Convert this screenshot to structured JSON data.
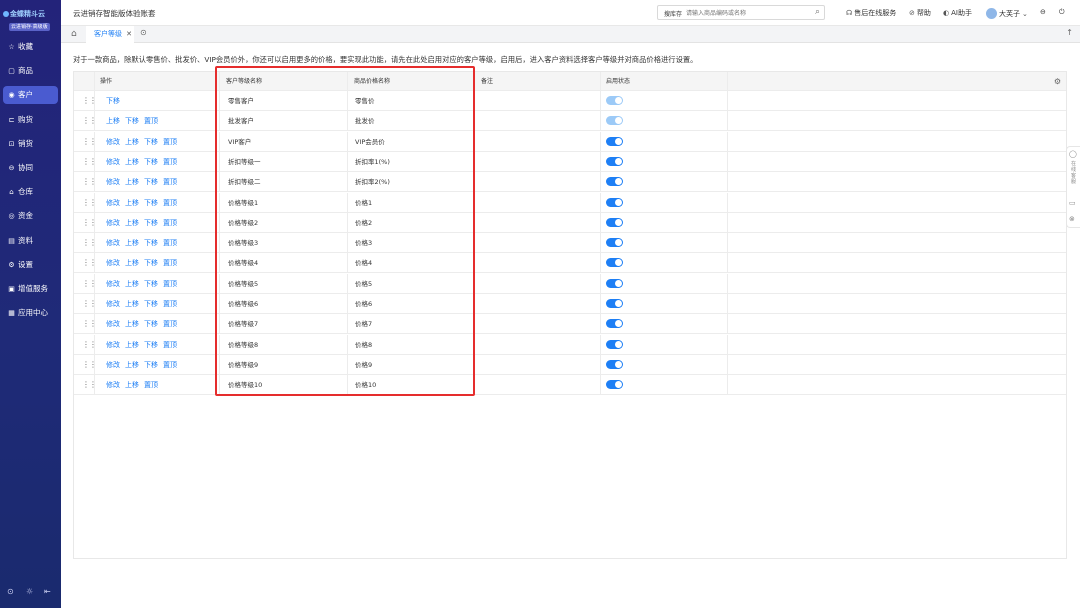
{
  "sidebar": {
    "brand": "金蝶精斗云",
    "edition": "云进销存·高级版",
    "items": [
      {
        "label": "收藏",
        "icon": "star-icon",
        "glyph": "☆",
        "active": false
      },
      {
        "label": "商品",
        "icon": "box-icon",
        "glyph": "▢",
        "active": false
      },
      {
        "label": "客户",
        "icon": "user-icon",
        "glyph": "◉",
        "active": true
      },
      {
        "label": "购货",
        "icon": "cart-icon",
        "glyph": "⊏",
        "active": false
      },
      {
        "label": "销货",
        "icon": "sales-icon",
        "glyph": "⊡",
        "active": false
      },
      {
        "label": "协同",
        "icon": "link-icon",
        "glyph": "⊖",
        "active": false
      },
      {
        "label": "仓库",
        "icon": "home-icon",
        "glyph": "⌂",
        "active": false
      },
      {
        "label": "资金",
        "icon": "coin-icon",
        "glyph": "◎",
        "active": false
      },
      {
        "label": "资料",
        "icon": "document-icon",
        "glyph": "▤",
        "active": false
      },
      {
        "label": "设置",
        "icon": "gear-icon",
        "glyph": "⚙",
        "active": false
      },
      {
        "label": "增值服务",
        "icon": "service-icon",
        "glyph": "▣",
        "active": false
      },
      {
        "label": "应用中心",
        "icon": "apps-icon",
        "glyph": "▦",
        "active": false
      }
    ],
    "bottom_icons": [
      "help-icon",
      "settings-icon",
      "collapse-icon"
    ]
  },
  "topbar": {
    "app_title": "云进销存智能版体验账套",
    "search_label": "搜库存",
    "search_placeholder": "请输入商品编码或名称",
    "service": "售后在线服务",
    "help": "帮助",
    "ai": "AI助手",
    "user": "大芙子"
  },
  "tabs": {
    "active_tab": "客户等级"
  },
  "notice": "对于一款商品，除默认零售价、批发价、VIP会员价外，你还可以启用更多的价格，要实现此功能，请先在此处启用对应的客户等级，启用后，进入客户资料选择客户等级并对商品价格进行设置。",
  "table": {
    "headers": {
      "ops": "操作",
      "level": "客户等级名称",
      "price": "商品价格名称",
      "remark": "备注",
      "status": "启用状态"
    },
    "rows": [
      {
        "ops": [
          "下移"
        ],
        "level": "零售客户",
        "price": "零售价",
        "enabled": true,
        "locked": true
      },
      {
        "ops": [
          "上移",
          "下移",
          "置顶"
        ],
        "level": "批发客户",
        "price": "批发价",
        "enabled": true,
        "locked": true
      },
      {
        "ops": [
          "修改",
          "上移",
          "下移",
          "置顶"
        ],
        "level": "VIP客户",
        "price": "VIP会员价",
        "enabled": true,
        "locked": false
      },
      {
        "ops": [
          "修改",
          "上移",
          "下移",
          "置顶"
        ],
        "level": "折扣等级一",
        "price": "折扣率1(%)",
        "enabled": true,
        "locked": false
      },
      {
        "ops": [
          "修改",
          "上移",
          "下移",
          "置顶"
        ],
        "level": "折扣等级二",
        "price": "折扣率2(%)",
        "enabled": true,
        "locked": false
      },
      {
        "ops": [
          "修改",
          "上移",
          "下移",
          "置顶"
        ],
        "level": "价格等级1",
        "price": "价格1",
        "enabled": true,
        "locked": false
      },
      {
        "ops": [
          "修改",
          "上移",
          "下移",
          "置顶"
        ],
        "level": "价格等级2",
        "price": "价格2",
        "enabled": true,
        "locked": false
      },
      {
        "ops": [
          "修改",
          "上移",
          "下移",
          "置顶"
        ],
        "level": "价格等级3",
        "price": "价格3",
        "enabled": true,
        "locked": false
      },
      {
        "ops": [
          "修改",
          "上移",
          "下移",
          "置顶"
        ],
        "level": "价格等级4",
        "price": "价格4",
        "enabled": true,
        "locked": false
      },
      {
        "ops": [
          "修改",
          "上移",
          "下移",
          "置顶"
        ],
        "level": "价格等级5",
        "price": "价格5",
        "enabled": true,
        "locked": false
      },
      {
        "ops": [
          "修改",
          "上移",
          "下移",
          "置顶"
        ],
        "level": "价格等级6",
        "price": "价格6",
        "enabled": true,
        "locked": false
      },
      {
        "ops": [
          "修改",
          "上移",
          "下移",
          "置顶"
        ],
        "level": "价格等级7",
        "price": "价格7",
        "enabled": true,
        "locked": false
      },
      {
        "ops": [
          "修改",
          "上移",
          "下移",
          "置顶"
        ],
        "level": "价格等级8",
        "price": "价格8",
        "enabled": true,
        "locked": false
      },
      {
        "ops": [
          "修改",
          "上移",
          "下移",
          "置顶"
        ],
        "level": "价格等级9",
        "price": "价格9",
        "enabled": true,
        "locked": false
      },
      {
        "ops": [
          "修改",
          "上移",
          "置顶"
        ],
        "level": "价格等级10",
        "price": "价格10",
        "enabled": true,
        "locked": false
      }
    ]
  },
  "right_dock": {
    "feedback": "在线客服"
  },
  "colors": {
    "accent": "#1e7ff5",
    "sidebar": "#23237a",
    "highlight": "#e52d2d"
  }
}
